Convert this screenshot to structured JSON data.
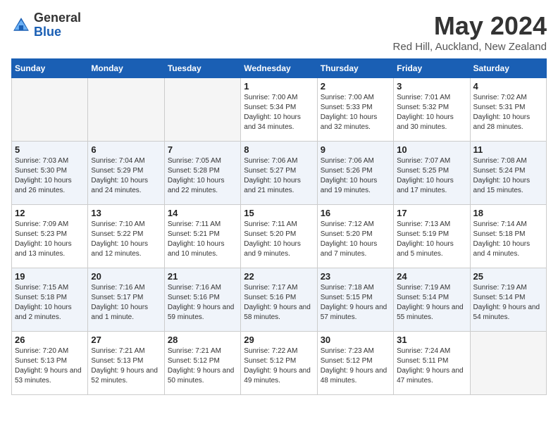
{
  "logo": {
    "general": "General",
    "blue": "Blue"
  },
  "title": "May 2024",
  "location": "Red Hill, Auckland, New Zealand",
  "days_of_week": [
    "Sunday",
    "Monday",
    "Tuesday",
    "Wednesday",
    "Thursday",
    "Friday",
    "Saturday"
  ],
  "weeks": [
    [
      {
        "day": "",
        "empty": true
      },
      {
        "day": "",
        "empty": true
      },
      {
        "day": "",
        "empty": true
      },
      {
        "day": "1",
        "sunrise": "7:00 AM",
        "sunset": "5:34 PM",
        "daylight": "10 hours and 34 minutes."
      },
      {
        "day": "2",
        "sunrise": "7:00 AM",
        "sunset": "5:33 PM",
        "daylight": "10 hours and 32 minutes."
      },
      {
        "day": "3",
        "sunrise": "7:01 AM",
        "sunset": "5:32 PM",
        "daylight": "10 hours and 30 minutes."
      },
      {
        "day": "4",
        "sunrise": "7:02 AM",
        "sunset": "5:31 PM",
        "daylight": "10 hours and 28 minutes."
      }
    ],
    [
      {
        "day": "5",
        "sunrise": "7:03 AM",
        "sunset": "5:30 PM",
        "daylight": "10 hours and 26 minutes."
      },
      {
        "day": "6",
        "sunrise": "7:04 AM",
        "sunset": "5:29 PM",
        "daylight": "10 hours and 24 minutes."
      },
      {
        "day": "7",
        "sunrise": "7:05 AM",
        "sunset": "5:28 PM",
        "daylight": "10 hours and 22 minutes."
      },
      {
        "day": "8",
        "sunrise": "7:06 AM",
        "sunset": "5:27 PM",
        "daylight": "10 hours and 21 minutes."
      },
      {
        "day": "9",
        "sunrise": "7:06 AM",
        "sunset": "5:26 PM",
        "daylight": "10 hours and 19 minutes."
      },
      {
        "day": "10",
        "sunrise": "7:07 AM",
        "sunset": "5:25 PM",
        "daylight": "10 hours and 17 minutes."
      },
      {
        "day": "11",
        "sunrise": "7:08 AM",
        "sunset": "5:24 PM",
        "daylight": "10 hours and 15 minutes."
      }
    ],
    [
      {
        "day": "12",
        "sunrise": "7:09 AM",
        "sunset": "5:23 PM",
        "daylight": "10 hours and 13 minutes."
      },
      {
        "day": "13",
        "sunrise": "7:10 AM",
        "sunset": "5:22 PM",
        "daylight": "10 hours and 12 minutes."
      },
      {
        "day": "14",
        "sunrise": "7:11 AM",
        "sunset": "5:21 PM",
        "daylight": "10 hours and 10 minutes."
      },
      {
        "day": "15",
        "sunrise": "7:11 AM",
        "sunset": "5:20 PM",
        "daylight": "10 hours and 9 minutes."
      },
      {
        "day": "16",
        "sunrise": "7:12 AM",
        "sunset": "5:20 PM",
        "daylight": "10 hours and 7 minutes."
      },
      {
        "day": "17",
        "sunrise": "7:13 AM",
        "sunset": "5:19 PM",
        "daylight": "10 hours and 5 minutes."
      },
      {
        "day": "18",
        "sunrise": "7:14 AM",
        "sunset": "5:18 PM",
        "daylight": "10 hours and 4 minutes."
      }
    ],
    [
      {
        "day": "19",
        "sunrise": "7:15 AM",
        "sunset": "5:18 PM",
        "daylight": "10 hours and 2 minutes."
      },
      {
        "day": "20",
        "sunrise": "7:16 AM",
        "sunset": "5:17 PM",
        "daylight": "10 hours and 1 minute."
      },
      {
        "day": "21",
        "sunrise": "7:16 AM",
        "sunset": "5:16 PM",
        "daylight": "9 hours and 59 minutes."
      },
      {
        "day": "22",
        "sunrise": "7:17 AM",
        "sunset": "5:16 PM",
        "daylight": "9 hours and 58 minutes."
      },
      {
        "day": "23",
        "sunrise": "7:18 AM",
        "sunset": "5:15 PM",
        "daylight": "9 hours and 57 minutes."
      },
      {
        "day": "24",
        "sunrise": "7:19 AM",
        "sunset": "5:14 PM",
        "daylight": "9 hours and 55 minutes."
      },
      {
        "day": "25",
        "sunrise": "7:19 AM",
        "sunset": "5:14 PM",
        "daylight": "9 hours and 54 minutes."
      }
    ],
    [
      {
        "day": "26",
        "sunrise": "7:20 AM",
        "sunset": "5:13 PM",
        "daylight": "9 hours and 53 minutes."
      },
      {
        "day": "27",
        "sunrise": "7:21 AM",
        "sunset": "5:13 PM",
        "daylight": "9 hours and 52 minutes."
      },
      {
        "day": "28",
        "sunrise": "7:21 AM",
        "sunset": "5:12 PM",
        "daylight": "9 hours and 50 minutes."
      },
      {
        "day": "29",
        "sunrise": "7:22 AM",
        "sunset": "5:12 PM",
        "daylight": "9 hours and 49 minutes."
      },
      {
        "day": "30",
        "sunrise": "7:23 AM",
        "sunset": "5:12 PM",
        "daylight": "9 hours and 48 minutes."
      },
      {
        "day": "31",
        "sunrise": "7:24 AM",
        "sunset": "5:11 PM",
        "daylight": "9 hours and 47 minutes."
      },
      {
        "day": "",
        "empty": true
      }
    ]
  ],
  "labels": {
    "sunrise": "Sunrise:",
    "sunset": "Sunset:",
    "daylight": "Daylight:"
  }
}
